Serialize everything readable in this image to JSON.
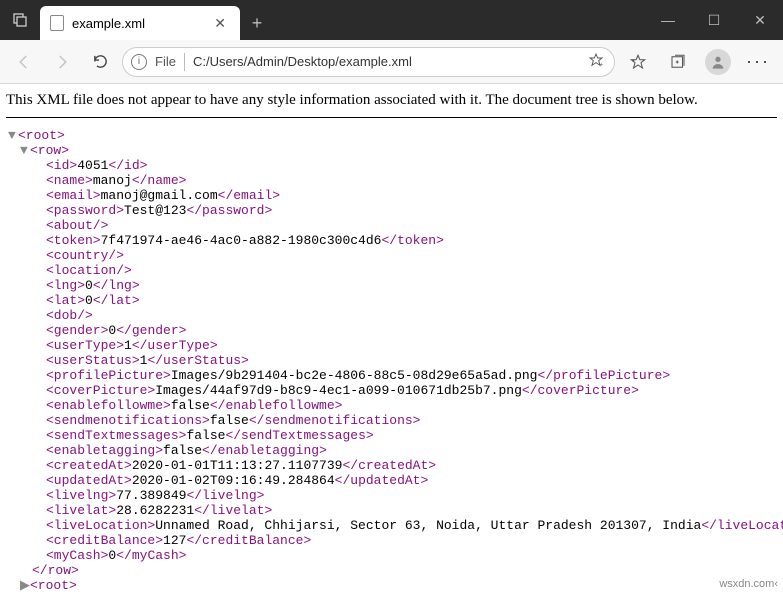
{
  "window": {
    "tab_title": "example.xml",
    "min": "—",
    "max": "☐",
    "close": "✕"
  },
  "toolbar": {
    "file_label": "File",
    "url": "C:/Users/Admin/Desktop/example.xml"
  },
  "banner": "This XML file does not appear to have any style information associated with it. The document tree is shown below.",
  "xml": {
    "root_open": "<root>",
    "row_open": "<row>",
    "row_close": "</row>",
    "root_close": "<root>",
    "fields": [
      {
        "tag": "id",
        "val": "4051",
        "close": true
      },
      {
        "tag": "name",
        "val": "manoj",
        "close": true
      },
      {
        "tag": "email",
        "val": "manoj@gmail.com",
        "close": true
      },
      {
        "tag": "password",
        "val": "Test@123",
        "close": true
      },
      {
        "tag": "about",
        "self": true
      },
      {
        "tag": "token",
        "val": "7f471974-ae46-4ac0-a882-1980c300c4d6",
        "close": true
      },
      {
        "tag": "country",
        "self": true
      },
      {
        "tag": "location",
        "self": true
      },
      {
        "tag": "lng",
        "val": "0",
        "close": true
      },
      {
        "tag": "lat",
        "val": "0",
        "close": true
      },
      {
        "tag": "dob",
        "self": true
      },
      {
        "tag": "gender",
        "val": "0",
        "close": true
      },
      {
        "tag": "userType",
        "val": "1",
        "close": true
      },
      {
        "tag": "userStatus",
        "val": "1",
        "close": true
      },
      {
        "tag": "profilePicture",
        "val": "Images/9b291404-bc2e-4806-88c5-08d29e65a5ad.png",
        "close": true
      },
      {
        "tag": "coverPicture",
        "val": "Images/44af97d9-b8c9-4ec1-a099-010671db25b7.png",
        "close": true
      },
      {
        "tag": "enablefollowme",
        "val": "false",
        "close": true
      },
      {
        "tag": "sendmenotifications",
        "val": "false",
        "close": true
      },
      {
        "tag": "sendTextmessages",
        "val": "false",
        "close": true
      },
      {
        "tag": "enabletagging",
        "val": "false",
        "close": true
      },
      {
        "tag": "createdAt",
        "val": "2020-01-01T11:13:27.1107739",
        "close": true
      },
      {
        "tag": "updatedAt",
        "val": "2020-01-02T09:16:49.284864",
        "close": true
      },
      {
        "tag": "livelng",
        "val": "77.389849",
        "close": true
      },
      {
        "tag": "livelat",
        "val": "28.6282231",
        "close": true
      },
      {
        "tag": "liveLocation",
        "val": "Unnamed Road, Chhijarsi, Sector 63, Noida, Uttar Pradesh 201307, India",
        "close": true
      },
      {
        "tag": "creditBalance",
        "val": "127",
        "close": true
      },
      {
        "tag": "myCash",
        "val": "0",
        "close": true
      }
    ]
  },
  "watermark": "wsxdn.com‹"
}
